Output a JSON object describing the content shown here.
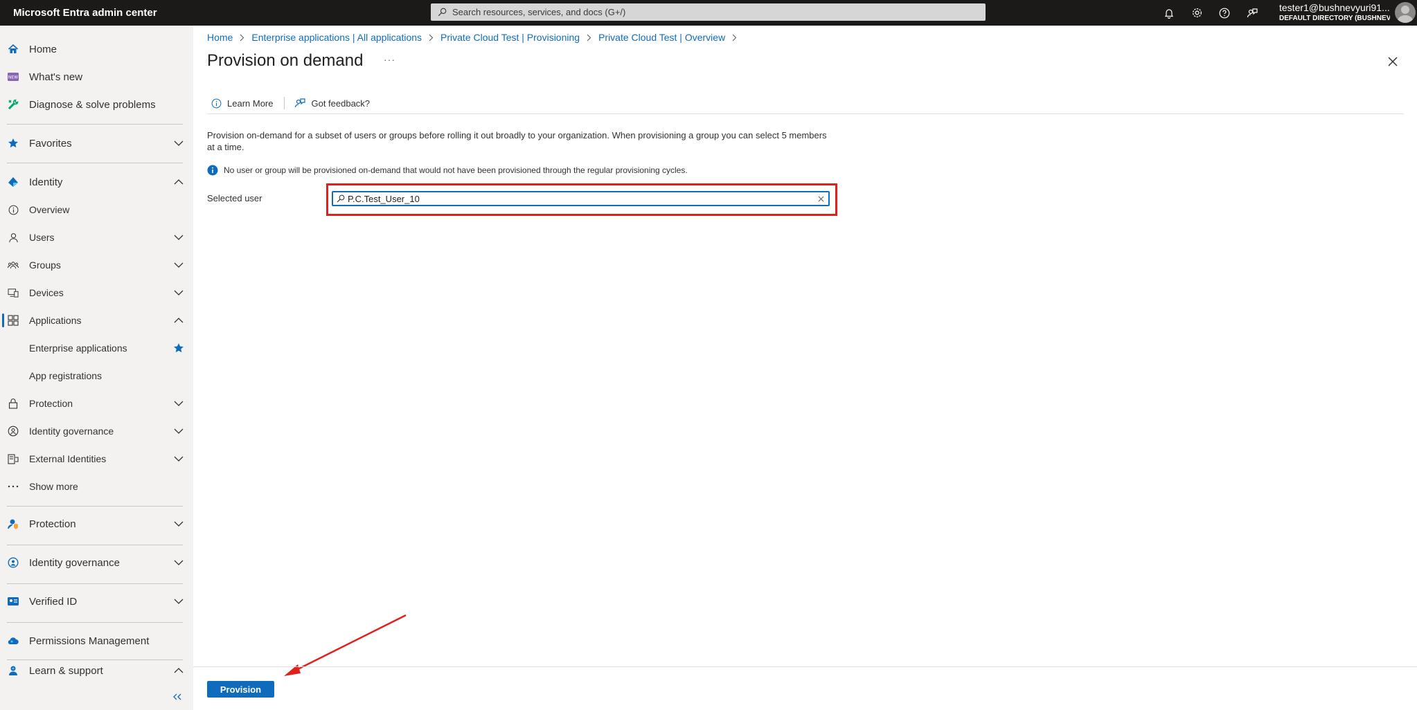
{
  "topbar": {
    "brand": "Microsoft Entra admin center",
    "search_placeholder": "Search resources, services, and docs (G+/)",
    "icons": [
      "bell-icon",
      "gear-icon",
      "help-icon",
      "feedback-icon"
    ],
    "account_name": "tester1@bushnevyuri91...",
    "account_directory": "DEFAULT DIRECTORY (BUSHNEV..."
  },
  "sidebar": {
    "home": "Home",
    "whats_new": "What's new",
    "diagnose": "Diagnose & solve problems",
    "favorites": "Favorites",
    "identity": "Identity",
    "overview": "Overview",
    "users": "Users",
    "groups": "Groups",
    "devices": "Devices",
    "applications": "Applications",
    "enterprise_apps": "Enterprise applications",
    "app_registrations": "App registrations",
    "protection_sub": "Protection",
    "identity_governance_sub": "Identity governance",
    "external_identities": "External Identities",
    "show_more": "Show more",
    "protection": "Protection",
    "identity_governance": "Identity governance",
    "verified_id": "Verified ID",
    "permissions_management": "Permissions Management",
    "learn_support": "Learn & support"
  },
  "breadcrumb": {
    "items": [
      "Home",
      "Enterprise applications | All applications",
      "Private Cloud Test | Provisioning",
      "Private Cloud Test | Overview"
    ]
  },
  "page": {
    "title": "Provision on demand",
    "more": "···"
  },
  "toolbar": {
    "learn_more": "Learn More",
    "feedback": "Got feedback?"
  },
  "content": {
    "description": "Provision on-demand for a subset of users or groups before rolling it out broadly to your organization. When provisioning a group you can select 5 members at a time.",
    "info": "No user or group will be provisioned on-demand that would not have been provisioned through the regular provisioning cycles.",
    "selected_user_label": "Selected user",
    "selected_user_value": "P.C.Test_User_10"
  },
  "footer": {
    "provision_label": "Provision"
  },
  "colors": {
    "accent": "#0f6cbd",
    "topbar": "#1b1a19",
    "sidebar": "#f3f2f1",
    "highlight": "#e0201b"
  }
}
